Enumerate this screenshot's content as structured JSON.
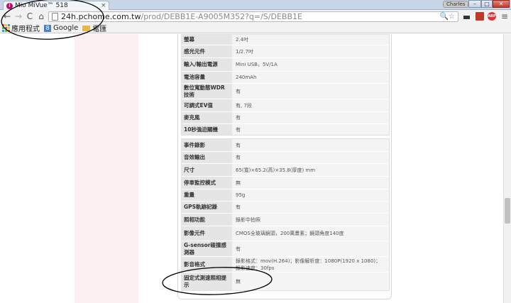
{
  "browser": {
    "tab_title": "Mio MiVue™ 518",
    "tab_favicon": "i",
    "tab_close": "×",
    "user_badge": "Charles",
    "url_host": "24h.pchome.com.tw",
    "url_path": "/prod/DEBB1E-A9005M352?q=/S/DEBB1E",
    "omnibox_icons": "🔍☆",
    "ext_abp_label": "ABP",
    "menu_glyph": "≡",
    "nav": {
      "back": "←",
      "forward": "→",
      "reload": "C",
      "home": "⌂"
    },
    "window": {
      "min": "–",
      "max": "□",
      "close": "✕"
    }
  },
  "bookmarks": [
    {
      "label": "應用程式",
      "icon": "apps-grid-icon"
    },
    {
      "label": "Google",
      "icon": "google-icon",
      "glyph": "8"
    },
    {
      "label": "電匯",
      "icon": "folder-icon"
    }
  ],
  "colors": {
    "accent_pink": "#fdf0f2",
    "label_bg": "#e5e5e5",
    "value_bg": "#f4f4f4",
    "annotation": "#000000"
  },
  "spec_groups": [
    {
      "rows": [
        {
          "label": "螢幕",
          "value": "2.4吋"
        },
        {
          "label": "感光元件",
          "value": "1/2.7吋"
        },
        {
          "label": "輸入/輸出電源",
          "value": "Mini USB，5V/1A"
        },
        {
          "label": "電池容量",
          "value": "240mAh"
        },
        {
          "label": "數位寬動態WDR技術",
          "value": "有"
        },
        {
          "label": "可調式EV值",
          "value": "有, 7段"
        },
        {
          "label": "麥克風",
          "value": "有"
        },
        {
          "label": "10秒強迫關機",
          "value": "有"
        }
      ]
    },
    {
      "rows": [
        {
          "label": "事件錄影",
          "value": "有"
        },
        {
          "label": "音效輸出",
          "value": "有"
        },
        {
          "label": "尺寸",
          "value": "65(寬)×65.2(高)×35.8(厚度) mm"
        },
        {
          "label": "停車監控模式",
          "value": "無"
        },
        {
          "label": "重量",
          "value": "95g"
        },
        {
          "label": "GPS軌跡記錄",
          "value": "有"
        },
        {
          "label": "照相功能",
          "value": "錄影中拍照"
        },
        {
          "label": "影像元件",
          "value": "CMOS全玻璃鏡頭，200萬畫素；鏡頭角度140度"
        },
        {
          "label": "G-sensor碰撞感測器",
          "value": "有"
        },
        {
          "label": "影音格式",
          "value": "錄影格式：mov(H.264)；影像解析度：1080P(1920 x 1080)；錄影速度：30fps"
        },
        {
          "label": "固定式測速照相提示",
          "value": "無"
        }
      ]
    }
  ]
}
